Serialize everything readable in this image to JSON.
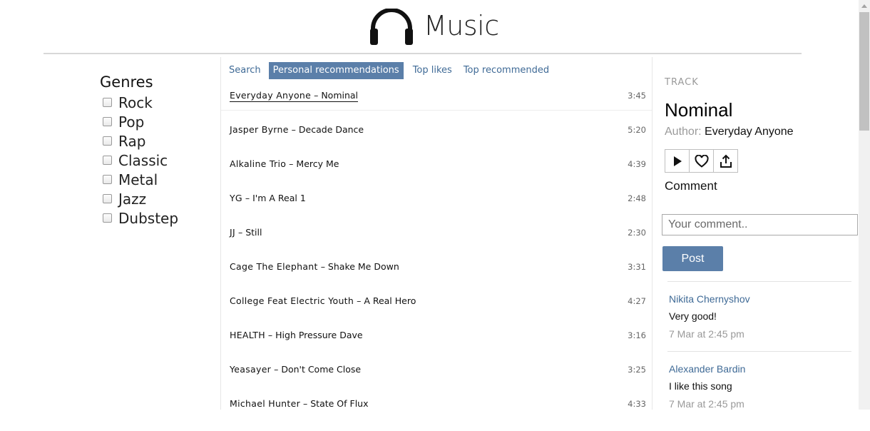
{
  "app": {
    "title": "Music"
  },
  "genres": {
    "title": "Genres",
    "items": [
      "Rock",
      "Pop",
      "Rap",
      "Classic",
      "Metal",
      "Jazz",
      "Dubstep"
    ]
  },
  "tabs": {
    "search": "Search",
    "personal": "Personal recommendations",
    "top_likes": "Top likes",
    "top_recommended": "Top recommended"
  },
  "tracks": [
    {
      "artist": "Everyday Anyone",
      "title": "Nominal",
      "duration": "3:45"
    },
    {
      "artist": "Jasper Byrne",
      "title": "Decade Dance",
      "duration": "5:20"
    },
    {
      "artist": "Alkaline Trio",
      "title": "Mercy Me",
      "duration": "4:39"
    },
    {
      "artist": "YG",
      "title": "I'm A Real 1",
      "duration": "2:48"
    },
    {
      "artist": "JJ",
      "title": "Still",
      "duration": "2:30"
    },
    {
      "artist": "Cage The Elephant",
      "title": "Shake Me Down",
      "duration": "3:31"
    },
    {
      "artist": "College Feat Electric Youth",
      "title": "A Real Hero",
      "duration": "4:27"
    },
    {
      "artist": "HEALTH",
      "title": "High Pressure Dave",
      "duration": "3:16"
    },
    {
      "artist": "Yeasayer",
      "title": "Don't Come Close",
      "duration": "3:25"
    },
    {
      "artist": "Michael Hunter",
      "title": "State Of Flux",
      "duration": "4:33"
    }
  ],
  "track_panel": {
    "caption": "TRACK",
    "title": "Nominal",
    "author_label": "Author:",
    "author": "Everyday Anyone",
    "comment_label": "Comment",
    "comment_placeholder": "Your comment..",
    "post_label": "Post"
  },
  "comments": [
    {
      "author": "Nikita Chernyshov",
      "text": "Very good!",
      "time": "7 Mar at 2:45 pm"
    },
    {
      "author": "Alexander Bardin",
      "text": "I like this song",
      "time": "7 Mar at 2:45 pm"
    }
  ],
  "icons": {
    "logo": "headphones-icon",
    "play": "play-icon",
    "like": "heart-icon",
    "share": "share-icon"
  },
  "colors": {
    "accent": "#5b7fa9",
    "link": "#3f6a96"
  }
}
